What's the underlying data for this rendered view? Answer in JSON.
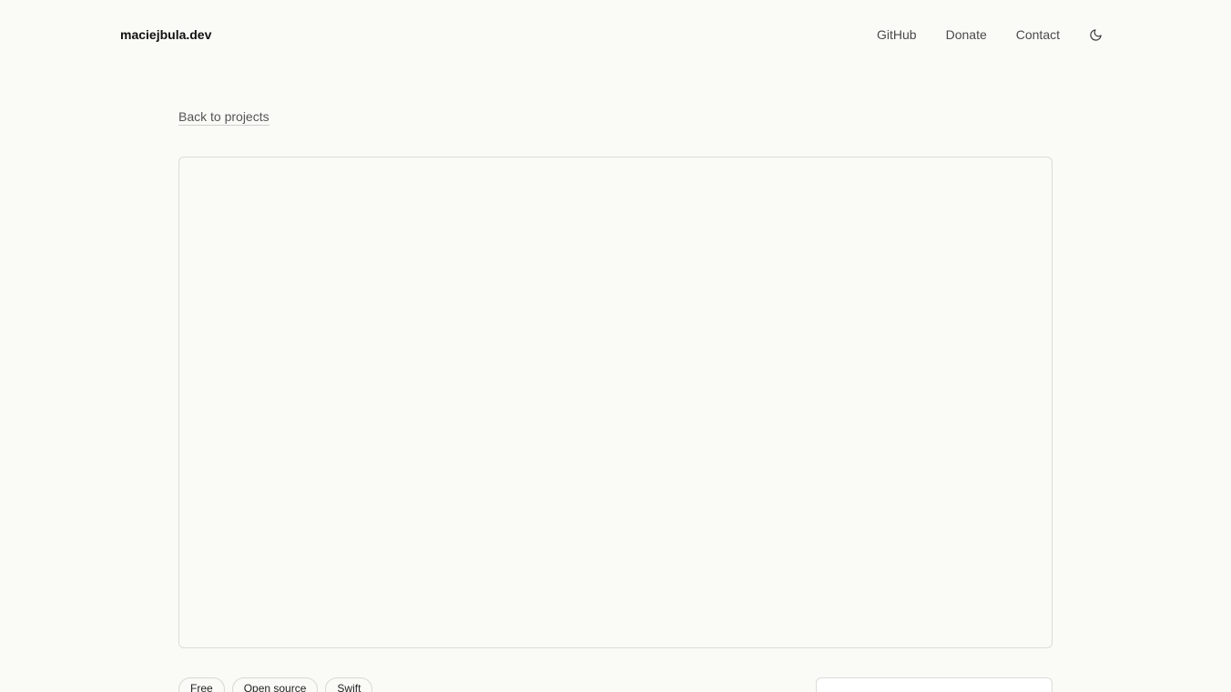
{
  "header": {
    "brand": "maciejbula.dev",
    "nav": {
      "github": "GitHub",
      "donate": "Donate",
      "contact": "Contact"
    },
    "theme_icon": "moon-icon"
  },
  "main": {
    "back_link": "Back to projects",
    "tags": [
      "Free",
      "Open source",
      "Swift"
    ]
  },
  "colors": {
    "background": "#fafaf7",
    "text": "#1a1a1a",
    "muted_text": "#4a4a4a",
    "border": "#dcdcd7"
  }
}
